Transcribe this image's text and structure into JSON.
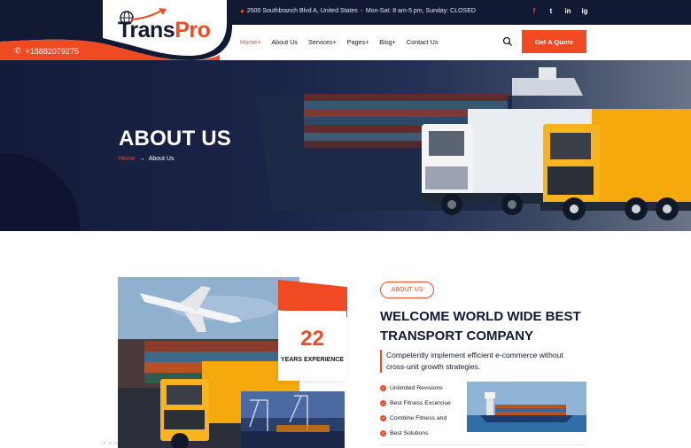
{
  "topbar": {
    "address": "2500 Southbranch Blvd A, United States",
    "hours": "Mon-Sat: 8 am-5 pm, Sunday: CLOSED",
    "social": [
      "f",
      "t",
      "in",
      "ig"
    ]
  },
  "brand": {
    "name_part1": "Trans",
    "name_part2": "Pro",
    "phone": "+18882079275",
    "colors": {
      "accent": "#f04a23",
      "navy": "#121a33"
    }
  },
  "nav": {
    "items": [
      "Home+",
      "About Us",
      "Services+",
      "Pages+",
      "Blog+",
      "Contact Us"
    ],
    "active_index": 0,
    "cta": "Get A Quote"
  },
  "hero": {
    "title": "ABOUT US",
    "breadcrumb_home": "Home",
    "breadcrumb_arrow": "→",
    "breadcrumb_current": "About Us"
  },
  "about": {
    "badge": "ABOUT US",
    "heading": "WELCOME WORLD WIDE BEST TRANSPORT COMPANY",
    "lead": "Competently implement efficient e-commerce without cross-unit growth strategies.",
    "experience_number": "22",
    "experience_label": "YEARS EXPERIENCE",
    "features": [
      "Unlimited Revisions",
      "Best Fitness Excercise",
      "Combine Fitness and",
      "Best Solutions"
    ],
    "dots": "· · ·"
  }
}
